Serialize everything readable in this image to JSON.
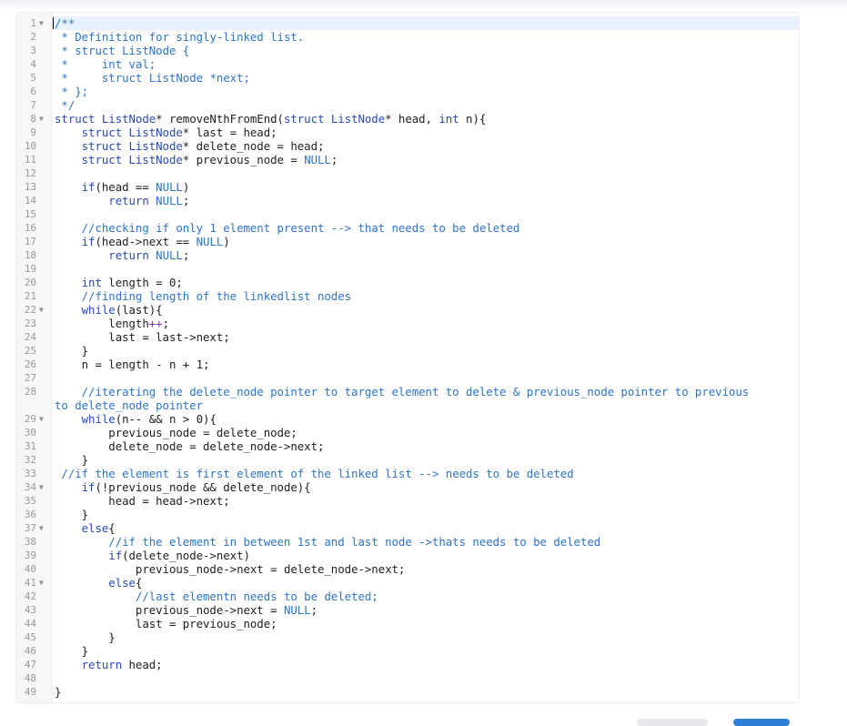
{
  "editor": {
    "fold_icon": "triangle-down",
    "lines": [
      {
        "n": "1",
        "fold": true,
        "segs": [
          {
            "c": "cmt",
            "t": "/**"
          }
        ]
      },
      {
        "n": "2",
        "segs": [
          {
            "c": "cmt",
            "t": " * Definition for singly-linked list."
          }
        ]
      },
      {
        "n": "3",
        "segs": [
          {
            "c": "cmt",
            "t": " * struct ListNode {"
          }
        ]
      },
      {
        "n": "4",
        "segs": [
          {
            "c": "cmt",
            "t": " *     int val;"
          }
        ]
      },
      {
        "n": "5",
        "segs": [
          {
            "c": "cmt",
            "t": " *     struct ListNode *next;"
          }
        ]
      },
      {
        "n": "6",
        "segs": [
          {
            "c": "cmt",
            "t": " * };"
          }
        ]
      },
      {
        "n": "7",
        "segs": [
          {
            "c": "cmt",
            "t": " */"
          }
        ]
      },
      {
        "n": "8",
        "fold": true,
        "segs": [
          {
            "c": "kw",
            "t": "struct ListNode"
          },
          {
            "c": "",
            "t": "* removeNthFromEnd("
          },
          {
            "c": "kw",
            "t": "struct ListNode"
          },
          {
            "c": "",
            "t": "* head, "
          },
          {
            "c": "kw",
            "t": "int"
          },
          {
            "c": "",
            "t": " n){"
          }
        ]
      },
      {
        "n": "9",
        "segs": [
          {
            "c": "",
            "t": "    "
          },
          {
            "c": "kw",
            "t": "struct ListNode"
          },
          {
            "c": "",
            "t": "* last = head;"
          }
        ]
      },
      {
        "n": "10",
        "segs": [
          {
            "c": "",
            "t": "    "
          },
          {
            "c": "kw",
            "t": "struct ListNode"
          },
          {
            "c": "",
            "t": "* delete_node = head;"
          }
        ]
      },
      {
        "n": "11",
        "segs": [
          {
            "c": "",
            "t": "    "
          },
          {
            "c": "kw",
            "t": "struct ListNode"
          },
          {
            "c": "",
            "t": "* previous_node = "
          },
          {
            "c": "cmt",
            "t": "NULL"
          },
          {
            "c": "",
            "t": ";"
          }
        ]
      },
      {
        "n": "12",
        "segs": [
          {
            "c": "",
            "t": ""
          }
        ]
      },
      {
        "n": "13",
        "segs": [
          {
            "c": "",
            "t": "    "
          },
          {
            "c": "kw",
            "t": "if"
          },
          {
            "c": "",
            "t": "(head == "
          },
          {
            "c": "cmt",
            "t": "NULL"
          },
          {
            "c": "",
            "t": ")"
          }
        ]
      },
      {
        "n": "14",
        "segs": [
          {
            "c": "",
            "t": "        "
          },
          {
            "c": "kw",
            "t": "return"
          },
          {
            "c": "",
            "t": " "
          },
          {
            "c": "cmt",
            "t": "NULL"
          },
          {
            "c": "",
            "t": ";"
          }
        ]
      },
      {
        "n": "15",
        "segs": [
          {
            "c": "",
            "t": ""
          }
        ]
      },
      {
        "n": "16",
        "segs": [
          {
            "c": "",
            "t": "    "
          },
          {
            "c": "cmt",
            "t": "//checking if only 1 element present --> that needs to be deleted"
          }
        ]
      },
      {
        "n": "17",
        "segs": [
          {
            "c": "",
            "t": "    "
          },
          {
            "c": "kw",
            "t": "if"
          },
          {
            "c": "",
            "t": "(head->next == "
          },
          {
            "c": "cmt",
            "t": "NULL"
          },
          {
            "c": "",
            "t": ")"
          }
        ]
      },
      {
        "n": "18",
        "segs": [
          {
            "c": "",
            "t": "        "
          },
          {
            "c": "kw",
            "t": "return"
          },
          {
            "c": "",
            "t": " "
          },
          {
            "c": "cmt",
            "t": "NULL"
          },
          {
            "c": "",
            "t": ";"
          }
        ]
      },
      {
        "n": "19",
        "segs": [
          {
            "c": "",
            "t": ""
          }
        ]
      },
      {
        "n": "20",
        "segs": [
          {
            "c": "",
            "t": "    "
          },
          {
            "c": "kw",
            "t": "int"
          },
          {
            "c": "",
            "t": " length = 0;"
          }
        ]
      },
      {
        "n": "21",
        "segs": [
          {
            "c": "",
            "t": "    "
          },
          {
            "c": "cmt",
            "t": "//finding length of the linkedlist nodes"
          }
        ]
      },
      {
        "n": "22",
        "fold": true,
        "segs": [
          {
            "c": "",
            "t": "    "
          },
          {
            "c": "kw",
            "t": "while"
          },
          {
            "c": "",
            "t": "(last){"
          }
        ]
      },
      {
        "n": "23",
        "segs": [
          {
            "c": "",
            "t": "        length"
          },
          {
            "c": "op",
            "t": "++"
          },
          {
            "c": "",
            "t": ";"
          }
        ]
      },
      {
        "n": "24",
        "segs": [
          {
            "c": "",
            "t": "        last = last->next;"
          }
        ]
      },
      {
        "n": "25",
        "segs": [
          {
            "c": "",
            "t": "    }"
          }
        ]
      },
      {
        "n": "26",
        "segs": [
          {
            "c": "",
            "t": "    n = length - n + 1;"
          }
        ]
      },
      {
        "n": "27",
        "segs": [
          {
            "c": "",
            "t": ""
          }
        ]
      },
      {
        "n": "28",
        "wrap": true,
        "segs": [
          {
            "c": "",
            "t": "    "
          },
          {
            "c": "cmt",
            "t": "//iterating the delete_node pointer to target element to delete & previous_node pointer to previous to delete_node pointer"
          }
        ]
      },
      {
        "n": "29",
        "fold": true,
        "segs": [
          {
            "c": "",
            "t": "    "
          },
          {
            "c": "kw",
            "t": "while"
          },
          {
            "c": "",
            "t": "(n-- && n > 0){"
          }
        ]
      },
      {
        "n": "30",
        "segs": [
          {
            "c": "",
            "t": "        previous_node = delete_node;"
          }
        ]
      },
      {
        "n": "31",
        "segs": [
          {
            "c": "",
            "t": "        delete_node = delete_node->next;"
          }
        ]
      },
      {
        "n": "32",
        "segs": [
          {
            "c": "",
            "t": "    }"
          }
        ]
      },
      {
        "n": "33",
        "segs": [
          {
            "c": "",
            "t": " "
          },
          {
            "c": "cmt",
            "t": "//if the element is first element of the linked list --> needs to be deleted"
          }
        ]
      },
      {
        "n": "34",
        "fold": true,
        "segs": [
          {
            "c": "",
            "t": "    "
          },
          {
            "c": "kw",
            "t": "if"
          },
          {
            "c": "",
            "t": "(!previous_node && delete_node){"
          }
        ]
      },
      {
        "n": "35",
        "segs": [
          {
            "c": "",
            "t": "        head = head->next;"
          }
        ]
      },
      {
        "n": "36",
        "segs": [
          {
            "c": "",
            "t": "    }"
          }
        ]
      },
      {
        "n": "37",
        "fold": true,
        "segs": [
          {
            "c": "",
            "t": "    "
          },
          {
            "c": "kw",
            "t": "else"
          },
          {
            "c": "",
            "t": "{"
          }
        ]
      },
      {
        "n": "38",
        "segs": [
          {
            "c": "",
            "t": "        "
          },
          {
            "c": "cmt",
            "t": "//if the element in between 1st and last node ->thats needs to be deleted"
          }
        ]
      },
      {
        "n": "39",
        "segs": [
          {
            "c": "",
            "t": "        "
          },
          {
            "c": "kw",
            "t": "if"
          },
          {
            "c": "",
            "t": "(delete_node->next)"
          }
        ]
      },
      {
        "n": "40",
        "segs": [
          {
            "c": "",
            "t": "            previous_node->next = delete_node->next;"
          }
        ]
      },
      {
        "n": "41",
        "fold": true,
        "segs": [
          {
            "c": "",
            "t": "        "
          },
          {
            "c": "kw",
            "t": "else"
          },
          {
            "c": "",
            "t": "{"
          }
        ]
      },
      {
        "n": "42",
        "segs": [
          {
            "c": "",
            "t": "            "
          },
          {
            "c": "cmt",
            "t": "//last elementn needs to be deleted;"
          }
        ]
      },
      {
        "n": "43",
        "segs": [
          {
            "c": "",
            "t": "            previous_node->next = "
          },
          {
            "c": "cmt",
            "t": "NULL"
          },
          {
            "c": "",
            "t": ";"
          }
        ]
      },
      {
        "n": "44",
        "segs": [
          {
            "c": "",
            "t": "            last = previous_node;"
          }
        ]
      },
      {
        "n": "45",
        "segs": [
          {
            "c": "",
            "t": "        }"
          }
        ]
      },
      {
        "n": "46",
        "segs": [
          {
            "c": "",
            "t": "    }"
          }
        ]
      },
      {
        "n": "47",
        "segs": [
          {
            "c": "",
            "t": "    "
          },
          {
            "c": "kw",
            "t": "return"
          },
          {
            "c": "",
            "t": " head;"
          }
        ]
      },
      {
        "n": "48",
        "segs": [
          {
            "c": "",
            "t": ""
          }
        ]
      },
      {
        "n": "49",
        "segs": [
          {
            "c": "",
            "t": "}"
          }
        ]
      }
    ]
  }
}
